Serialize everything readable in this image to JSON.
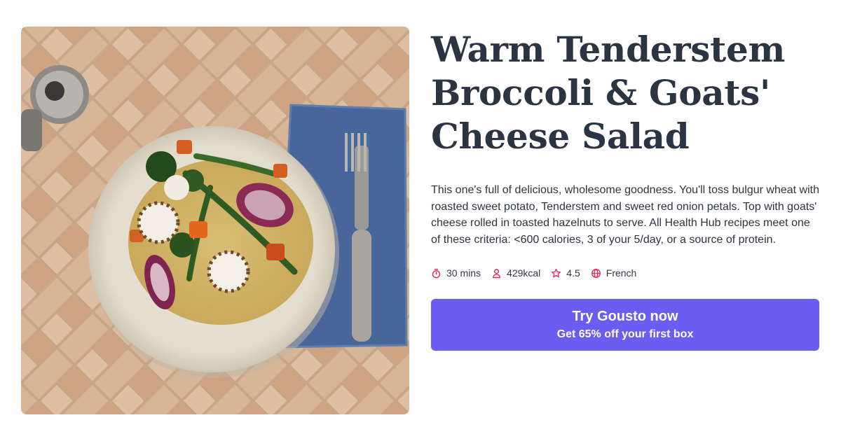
{
  "recipe": {
    "title": "Warm Tenderstem Broccoli & Goats' Cheese Salad",
    "description": "This one's full of delicious, wholesome goodness. You'll toss bulgur wheat with roasted sweet potato, Tenderstem and sweet red onion petals. Top with goats' cheese rolled in toasted hazelnuts to serve. All Health Hub recipes meet one of these criteria: <600 calories, 3 of your 5/day, or a source of protein.",
    "meta": {
      "time": "30 mins",
      "calories": "429kcal",
      "rating": "4.5",
      "cuisine": "French"
    },
    "meta_icons": [
      "timer-icon",
      "person-icon",
      "star-icon",
      "globe-icon"
    ]
  },
  "cta": {
    "title": "Try Gousto now",
    "subtitle": "Get 65% off your first box"
  },
  "colors": {
    "title_text": "#2b3443",
    "icon_accent": "#e0284f",
    "cta_background": "#6b5cf2",
    "cta_text": "#ffffff"
  }
}
